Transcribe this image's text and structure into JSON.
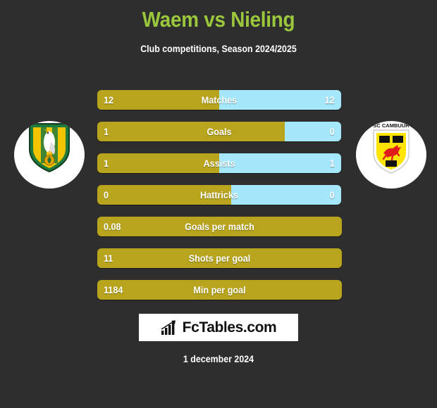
{
  "header": {
    "title": "Waem vs Nieling",
    "subtitle": "Club competitions, Season 2024/2025",
    "title_color": "#9ac73b"
  },
  "teams": {
    "home": {
      "crest_name": "ado-den-haag-crest",
      "crest_text": "ADO DEN HAAG"
    },
    "away": {
      "crest_name": "sc-cambuur-crest",
      "crest_text": "SC CAMBUUR"
    }
  },
  "colors": {
    "background": "#2e2e2e",
    "home_bar": "#b8a51d",
    "away_bar": "#a5e7fb",
    "text": "#ffffff"
  },
  "chart_data": {
    "type": "bar",
    "title": "Waem vs Nieling",
    "subtitle": "Club competitions, Season 2024/2025",
    "orientation": "horizontal-diverging",
    "series": [
      {
        "name": "Waem",
        "color": "#b8a51d"
      },
      {
        "name": "Nieling",
        "color": "#a5e7fb"
      }
    ],
    "categories": [
      "Matches",
      "Goals",
      "Assists",
      "Hattricks",
      "Goals per match",
      "Shots per goal",
      "Min per goal"
    ],
    "rows": [
      {
        "label": "Matches",
        "home": "12",
        "away": "12",
        "home_pct": 50,
        "two_sided": true
      },
      {
        "label": "Goals",
        "home": "1",
        "away": "0",
        "home_pct": 77,
        "two_sided": true
      },
      {
        "label": "Assists",
        "home": "1",
        "away": "1",
        "home_pct": 50,
        "two_sided": true
      },
      {
        "label": "Hattricks",
        "home": "0",
        "away": "0",
        "home_pct": 55,
        "two_sided": true
      },
      {
        "label": "Goals per match",
        "home": "0.08",
        "away": "",
        "home_pct": 100,
        "two_sided": false
      },
      {
        "label": "Shots per goal",
        "home": "11",
        "away": "",
        "home_pct": 100,
        "two_sided": false
      },
      {
        "label": "Min per goal",
        "home": "1184",
        "away": "",
        "home_pct": 100,
        "two_sided": false
      }
    ]
  },
  "footer": {
    "logo_text": "FcTables.com",
    "logo_icon": "bar-chart-icon",
    "date": "1 december 2024"
  }
}
